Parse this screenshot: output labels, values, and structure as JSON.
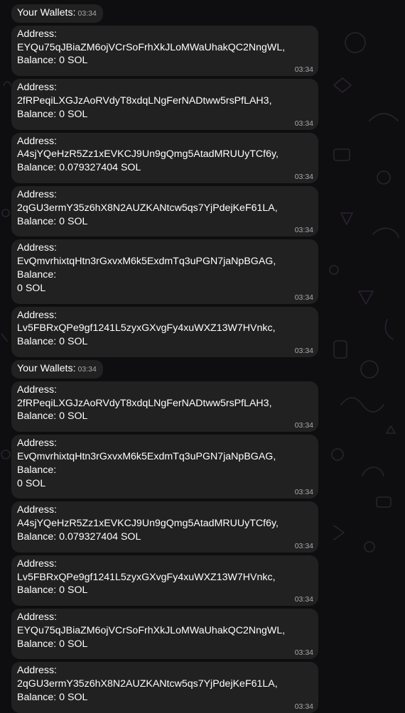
{
  "messages": [
    {
      "type": "header",
      "text": "Your Wallets:",
      "time": "03:34"
    },
    {
      "type": "wallet",
      "lines": [
        "Address:",
        "EYQu75qJBiaZM6ojVCrSoFrhXkJLoMWaUhakQC2NngWL,",
        "Balance: 0 SOL"
      ],
      "time": "03:34"
    },
    {
      "type": "wallet",
      "lines": [
        "Address: 2fRPeqiLXGJzAoRVdyT8xdqLNgFerNADtww5rsPfLAH3,",
        "Balance: 0 SOL"
      ],
      "time": "03:34"
    },
    {
      "type": "wallet",
      "lines": [
        "Address:",
        "A4sjYQeHzR5Zz1xEVKCJ9Un9gQmg5AtadMRUUyTCf6y,",
        "Balance: 0.079327404 SOL"
      ],
      "time": "03:34"
    },
    {
      "type": "wallet",
      "lines": [
        "Address:",
        "2qGU3ermY35z6hX8N2AUZKANtcw5qs7YjPdejKeF61LA,",
        "Balance: 0 SOL"
      ],
      "time": "03:34"
    },
    {
      "type": "wallet",
      "lines": [
        "Address:",
        "EvQmvrhixtqHtn3rGxvxM6k5ExdmTq3uPGN7jaNpBGAG, Balance:",
        "0 SOL"
      ],
      "time": "03:34"
    },
    {
      "type": "wallet",
      "lines": [
        "Address: Lv5FBRxQPe9gf1241L5zyxGXvgFy4xuWXZ13W7HVnkc,",
        "Balance: 0 SOL"
      ],
      "time": "03:34"
    },
    {
      "type": "header",
      "text": "Your Wallets:",
      "time": "03:34"
    },
    {
      "type": "wallet",
      "lines": [
        "Address: 2fRPeqiLXGJzAoRVdyT8xdqLNgFerNADtww5rsPfLAH3,",
        "Balance: 0 SOL"
      ],
      "time": "03:34"
    },
    {
      "type": "wallet",
      "lines": [
        "Address:",
        "EvQmvrhixtqHtn3rGxvxM6k5ExdmTq3uPGN7jaNpBGAG, Balance:",
        "0 SOL"
      ],
      "time": "03:34"
    },
    {
      "type": "wallet",
      "lines": [
        "Address:",
        "A4sjYQeHzR5Zz1xEVKCJ9Un9gQmg5AtadMRUUyTCf6y,",
        "Balance: 0.079327404 SOL"
      ],
      "time": "03:34"
    },
    {
      "type": "wallet",
      "lines": [
        "Address: Lv5FBRxQPe9gf1241L5zyxGXvgFy4xuWXZ13W7HVnkc,",
        "Balance: 0 SOL"
      ],
      "time": "03:34"
    },
    {
      "type": "wallet",
      "lines": [
        "Address:",
        "EYQu75qJBiaZM6ojVCrSoFrhXkJLoMWaUhakQC2NngWL,",
        "Balance: 0 SOL"
      ],
      "time": "03:34"
    },
    {
      "type": "wallet",
      "lines": [
        "Address:",
        "2qGU3ermY35z6hX8N2AUZKANtcw5qs7YjPdejKeF61LA,",
        "Balance: 0 SOL"
      ],
      "time": "03:34"
    }
  ],
  "theme": {
    "background": "#0e0e10",
    "bubble": "#212121",
    "text": "#ffffff",
    "time": "#aaaaaa",
    "doodle": "#2a2230"
  }
}
